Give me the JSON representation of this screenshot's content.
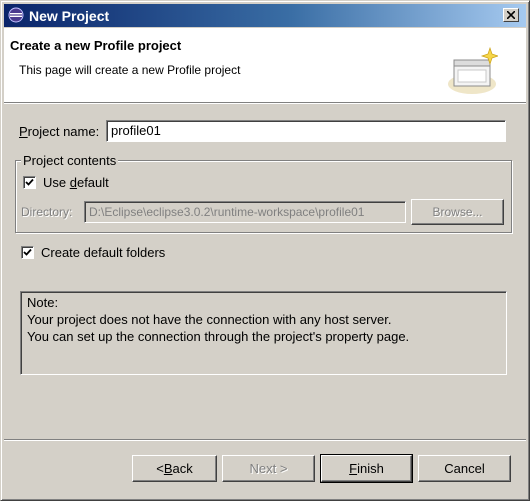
{
  "window": {
    "title": "New Project"
  },
  "banner": {
    "title": "Create a new Profile project",
    "description": "This page will create a new Profile project"
  },
  "form": {
    "project_name_label_prefix": "P",
    "project_name_label_rest": "roject name:",
    "project_name_value": "profile01",
    "contents_legend": "Project contents",
    "use_default_pre": "Use ",
    "use_default_mn": "d",
    "use_default_rest": "efault",
    "use_default_checked": true,
    "directory_label": "Directory:",
    "directory_value": "D:\\Eclipse\\eclipse3.0.2\\runtime-workspace\\profile01",
    "browse_label": "Browse...",
    "create_folders_label": "Create default folders",
    "create_folders_checked": true
  },
  "note": {
    "lines": [
      "Note:",
      "Your project does not have the connection with any host server.",
      "You can set up the connection through the project's property page."
    ]
  },
  "buttons": {
    "back_pre": "< ",
    "back_mn": "B",
    "back_rest": "ack",
    "next": "Next >",
    "finish_mn": "F",
    "finish_rest": "inish",
    "cancel": "Cancel"
  }
}
